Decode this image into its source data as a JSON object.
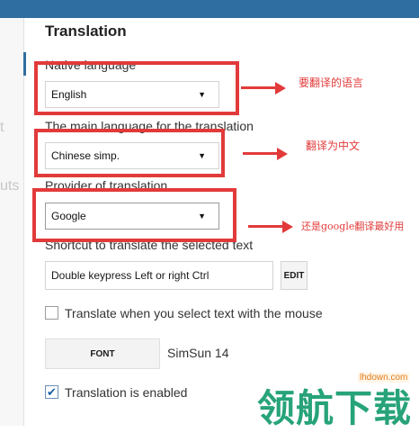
{
  "section_title": "Translation",
  "sidebar": {
    "fragment_1": "t",
    "fragment_2": "uts"
  },
  "native_language": {
    "label": "Native language",
    "value": "English"
  },
  "main_language": {
    "label": "The main language for the translation",
    "value": "Chinese simp."
  },
  "provider": {
    "label": "Provider of translation",
    "value": "Google"
  },
  "shortcut": {
    "label": "Shortcut to translate the selected text",
    "value": "Double keypress Left or right Ctrl",
    "edit_label": "EDIT"
  },
  "translate_on_select": {
    "label": "Translate when you select text with the mouse",
    "checked": false
  },
  "font": {
    "button_label": "FONT",
    "value": "SimSun 14"
  },
  "translation_enabled": {
    "label": "Translation is enabled",
    "checked": true,
    "mark": "✔"
  },
  "annotations": {
    "note_1": "要翻译的语言",
    "note_2": "翻译为中文",
    "note_3": "还是google翻译最好用"
  },
  "watermark": {
    "small": "lhdown.com",
    "big": "领航下载"
  },
  "colors": {
    "accent": "#2f6ea0",
    "annotation_red": "#e23a3a",
    "watermark_green": "#27a37a"
  }
}
